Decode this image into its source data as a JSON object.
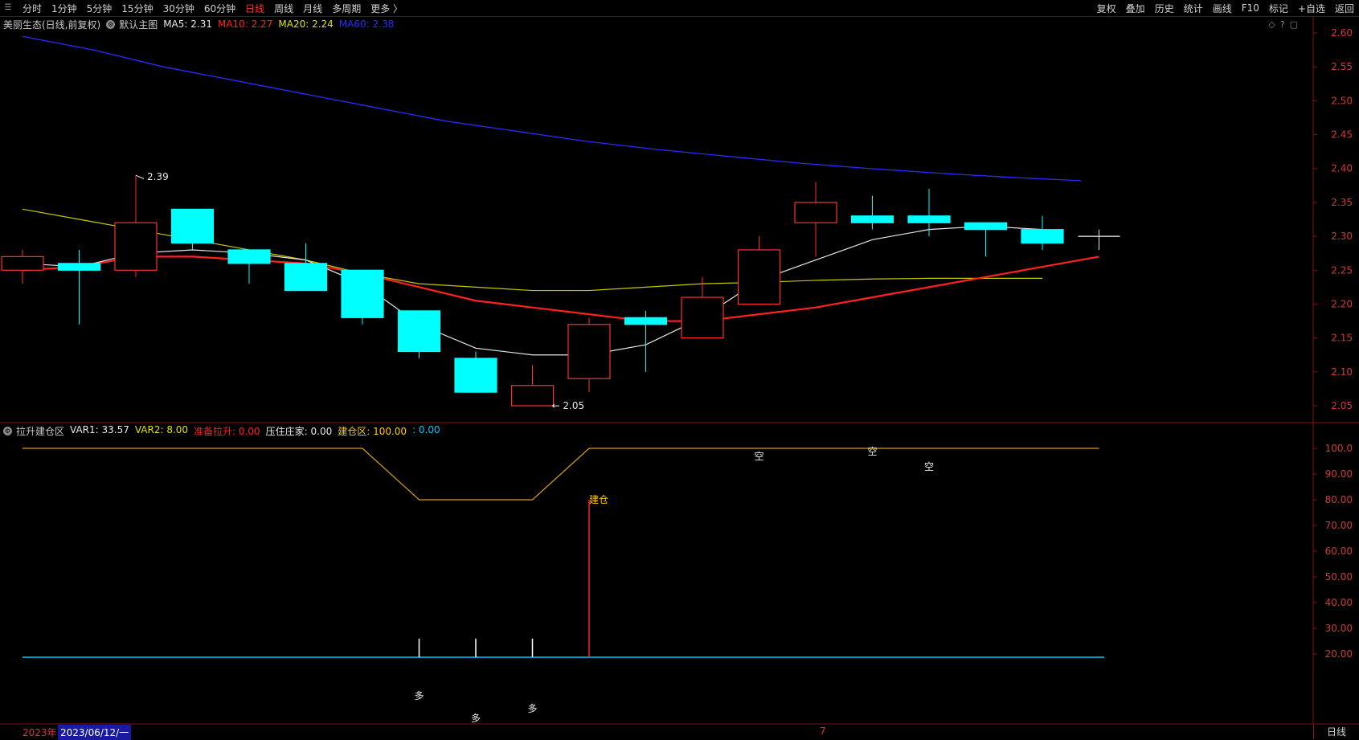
{
  "toolbar": {
    "periods": [
      "分时",
      "1分钟",
      "5分钟",
      "15分钟",
      "30分钟",
      "60分钟",
      "日线",
      "周线",
      "月线",
      "多周期",
      "更多 〉"
    ],
    "active_period": "日线",
    "right_tools": [
      "复权",
      "叠加",
      "历史",
      "统计",
      "画线",
      "F10",
      "标记",
      "+自选",
      "返回"
    ]
  },
  "main": {
    "title": "美丽生态(日线,前复权)",
    "template": "默认主图",
    "ma": [
      {
        "label": "MA5: 2.31",
        "color": "#e8e8e8"
      },
      {
        "label": "MA10: 2.27",
        "color": "#ff2020"
      },
      {
        "label": "MA20: 2.24",
        "color": "#e0e000"
      },
      {
        "label": "MA60: 2.38",
        "color": "#2a2aff"
      }
    ],
    "y_labels": [
      "2.60",
      "2.55",
      "2.50",
      "2.45",
      "2.40",
      "2.35",
      "2.30",
      "2.25",
      "2.20",
      "2.15",
      "2.10",
      "2.05"
    ],
    "high_label": "2.39",
    "low_label": "← 2.05"
  },
  "indicator": {
    "title": "拉升建仓区",
    "legend": [
      {
        "label": "VAR1: 33.57",
        "color": "#e8e8e8"
      },
      {
        "label": "VAR2: 8.00",
        "color": "#e0e000"
      },
      {
        "label": "准备拉升: 0.00",
        "color": "#ff2020"
      },
      {
        "label": "压住庄家: 0.00",
        "color": "#e8e8e8"
      },
      {
        "label": "建仓区: 100.00",
        "color": "#ffcc00"
      },
      {
        "label": ": 0.00",
        "color": "#00c8ff"
      }
    ],
    "y_labels": [
      "100.0",
      "90.00",
      "80.00",
      "70.00",
      "60.00",
      "50.00",
      "40.00",
      "30.00",
      "20.00"
    ],
    "jiancang_label": "建仓",
    "duo_label": "多",
    "kong_label": "空"
  },
  "footer": {
    "year": "2023年",
    "cursor_date": "2023/06/12/一",
    "mark": "7",
    "period": "日线"
  },
  "chart_data": {
    "type": "candlestick",
    "candles": [
      {
        "open": 2.25,
        "close": 2.27,
        "high": 2.28,
        "low": 2.23
      },
      {
        "open": 2.26,
        "close": 2.25,
        "high": 2.28,
        "low": 2.17
      },
      {
        "open": 2.25,
        "close": 2.32,
        "high": 2.39,
        "low": 2.24
      },
      {
        "open": 2.34,
        "close": 2.29,
        "high": 2.34,
        "low": 2.28
      },
      {
        "open": 2.28,
        "close": 2.26,
        "high": 2.28,
        "low": 2.23
      },
      {
        "open": 2.26,
        "close": 2.22,
        "high": 2.29,
        "low": 2.22
      },
      {
        "open": 2.25,
        "close": 2.18,
        "high": 2.25,
        "low": 2.17
      },
      {
        "open": 2.19,
        "close": 2.13,
        "high": 2.19,
        "low": 2.12
      },
      {
        "open": 2.12,
        "close": 2.07,
        "high": 2.13,
        "low": 2.07
      },
      {
        "open": 2.05,
        "close": 2.08,
        "high": 2.11,
        "low": 2.05
      },
      {
        "open": 2.09,
        "close": 2.17,
        "high": 2.18,
        "low": 2.07
      },
      {
        "open": 2.18,
        "close": 2.17,
        "high": 2.19,
        "low": 2.1
      },
      {
        "open": 2.15,
        "close": 2.21,
        "high": 2.24,
        "low": 2.15
      },
      {
        "open": 2.2,
        "close": 2.28,
        "high": 2.3,
        "low": 2.2
      },
      {
        "open": 2.32,
        "close": 2.35,
        "high": 2.38,
        "low": 2.27
      },
      {
        "open": 2.33,
        "close": 2.32,
        "high": 2.36,
        "low": 2.31
      },
      {
        "open": 2.33,
        "close": 2.32,
        "high": 2.37,
        "low": 2.3
      },
      {
        "open": 2.32,
        "close": 2.31,
        "high": 2.32,
        "low": 2.27
      },
      {
        "open": 2.31,
        "close": 2.29,
        "high": 2.33,
        "low": 2.28
      },
      {
        "open": 2.3,
        "close": 2.3,
        "high": 2.31,
        "low": 2.28
      }
    ],
    "ma5": [
      2.26,
      2.255,
      2.275,
      2.28,
      2.275,
      2.265,
      2.23,
      2.17,
      2.135,
      2.125,
      2.125,
      2.14,
      2.18,
      2.235,
      2.265,
      2.295,
      2.31,
      2.315,
      2.31
    ],
    "ma10": [
      2.25,
      2.255,
      2.27,
      2.27,
      2.265,
      2.26,
      2.245,
      2.225,
      2.205,
      2.195,
      2.185,
      2.175,
      2.175,
      2.185,
      2.195,
      2.21,
      2.225,
      2.24,
      2.255,
      2.27
    ],
    "ma20": [
      2.34,
      2.325,
      2.31,
      2.295,
      2.28,
      2.265,
      2.245,
      2.23,
      2.225,
      2.22,
      2.22,
      2.225,
      2.23,
      2.232,
      2.235,
      2.237,
      2.238,
      2.238,
      2.238
    ],
    "ma60": [
      2.595,
      2.575,
      2.55,
      2.53,
      2.51,
      2.49,
      2.47,
      2.455,
      2.44,
      2.428,
      2.418,
      2.408,
      2.4,
      2.393,
      2.387,
      2.382
    ],
    "ind_upper": [
      100,
      100,
      100,
      100,
      100,
      100,
      100,
      80,
      80,
      80,
      100,
      100,
      100,
      100,
      100,
      100,
      100,
      100,
      100,
      100
    ],
    "ind_bars_white": [
      7,
      8,
      9
    ],
    "ind_bar_white_value": 26,
    "ind_bar_red_index": 10,
    "ind_bar_red_value": 80,
    "ind_baseline": 0
  }
}
